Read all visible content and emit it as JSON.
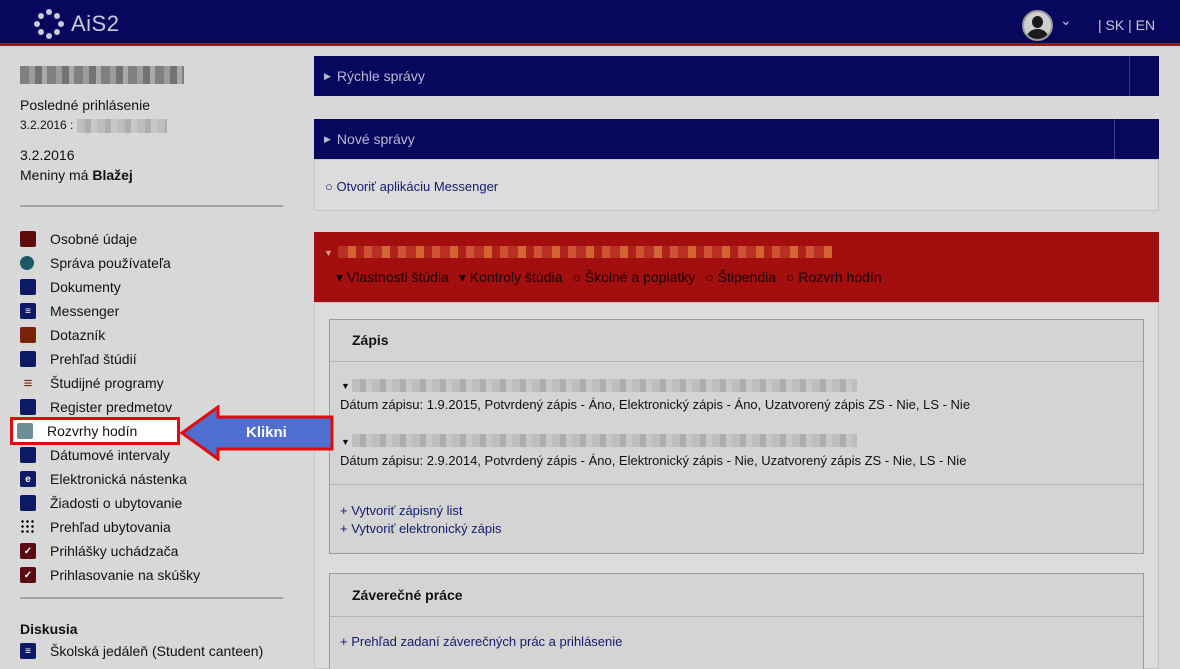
{
  "header": {
    "logo_text": "AiS2",
    "lang": "| SK | EN"
  },
  "sidebar": {
    "last_login_label": "Posledné prihlásenie",
    "last_login_date": "3.2.2016 :",
    "today": "3.2.2016",
    "nameday_prefix": "Meniny má",
    "nameday_name": "Blažej",
    "items": [
      {
        "label": "Osobné údaje",
        "icon": "person-icon"
      },
      {
        "label": "Správa používateľa",
        "icon": "users-icon"
      },
      {
        "label": "Dokumenty",
        "icon": "document-icon"
      },
      {
        "label": "Messenger",
        "icon": "chat-icon"
      },
      {
        "label": "Dotazník",
        "icon": "briefcase-icon"
      },
      {
        "label": "Prehľad štúdií",
        "icon": "document-list-icon"
      },
      {
        "label": "Študijné programy",
        "icon": "list-icon"
      },
      {
        "label": "Register predmetov",
        "icon": "folder-icon"
      },
      {
        "label": "Rozvrhy hodín",
        "icon": "calendar-icon"
      },
      {
        "label": "Dátumové intervaly",
        "icon": "calendar-interval-icon"
      },
      {
        "label": "Elektronická nástenka",
        "icon": "board-icon"
      },
      {
        "label": "Žiadosti o ubytovanie",
        "icon": "building-icon"
      },
      {
        "label": "Prehľad ubytovania",
        "icon": "grid-dots-icon"
      },
      {
        "label": "Prihlášky uchádzača",
        "icon": "application-icon"
      },
      {
        "label": "Prihlasovanie na skúšky",
        "icon": "exam-icon"
      }
    ],
    "section_title": "Diskusia",
    "section_items": [
      {
        "label": "Školská jedáleň (Student canteen)",
        "icon": "chat-icon"
      }
    ]
  },
  "callout": {
    "label": "Klikni"
  },
  "panels": {
    "quick_messages": "Rýchle správy",
    "new_messages": "Nové správy",
    "messenger_link": "○ Otvoriť aplikáciu Messenger"
  },
  "study": {
    "tabs": [
      "▾ Vlastnosti štúdia",
      "▾ Kontroly štúdia",
      "○ Školné a poplatky",
      "○ Štipendia",
      "○ Rozvrh hodín"
    ],
    "enrollment_title": "Zápis",
    "enrollment_1": "Dátum zápisu: 1.9.2015, Potvrdený zápis - Áno, Elektronický zápis - Áno, Uzatvorený zápis ZS - Nie, LS - Nie",
    "enrollment_2": "Dátum zápisu: 2.9.2014, Potvrdený zápis - Áno, Elektronický zápis - Nie, Uzatvorený zápis ZS - Nie, LS - Nie",
    "create_sheet": "+ Vytvoriť zápisný list",
    "create_electronic": "+ Vytvoriť elektronický zápis",
    "thesis_title": "Záverečné práce",
    "thesis_link": "+ Prehľad zadaní záverečných prác a prihlásenie"
  },
  "colors": {
    "header_bg": "#07075e",
    "highlight_border": "#e00b0b",
    "callout_blue": "#4f6fd0",
    "study_red": "#a30f0f"
  }
}
